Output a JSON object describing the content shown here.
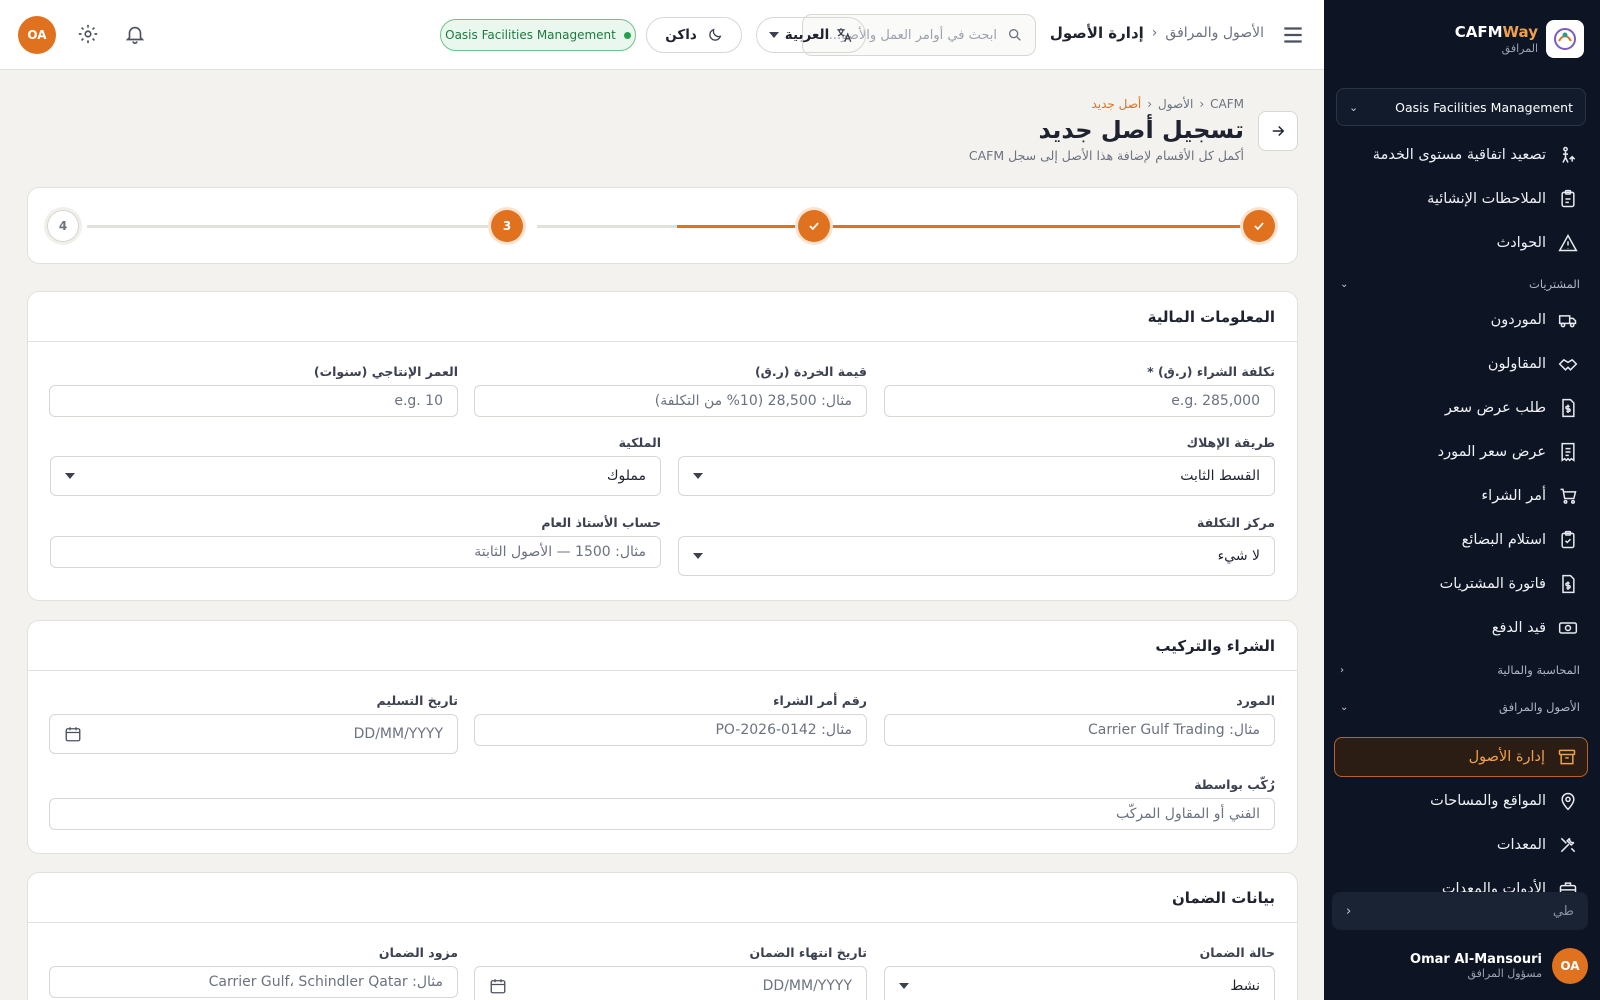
{
  "sidebar": {
    "brand": {
      "name_main": "CAFM",
      "name_accent": "Way",
      "subtitle": "المرافق"
    },
    "org": "Oasis Facilities Management",
    "items_top": [
      {
        "label": "تصعيد اتفاقية مستوى الخدمة",
        "icon": "escalation-icon"
      },
      {
        "label": "الملاحظات الإنشائية",
        "icon": "clipboard-icon"
      },
      {
        "label": "الحوادث",
        "icon": "warning-icon"
      }
    ],
    "section_procurement": "المشتريات",
    "items_procurement": [
      {
        "label": "الموردون",
        "icon": "truck-icon"
      },
      {
        "label": "المقاولون",
        "icon": "handshake-icon"
      },
      {
        "label": "طلب عرض سعر",
        "icon": "file-dollar-icon"
      },
      {
        "label": "عرض سعر المورد",
        "icon": "receipt-icon"
      },
      {
        "label": "أمر الشراء",
        "icon": "cart-icon"
      },
      {
        "label": "استلام البضائع",
        "icon": "clipboard-check-icon"
      },
      {
        "label": "فاتورة المشتريات",
        "icon": "invoice-icon"
      },
      {
        "label": "قيد الدفع",
        "icon": "cash-icon"
      }
    ],
    "section_accounting": "المحاسبة والمالية",
    "section_assets": "الأصول والمرافق",
    "items_assets": [
      {
        "label": "إدارة الأصول",
        "icon": "archive-icon",
        "active": true
      },
      {
        "label": "المواقع والمساحات",
        "icon": "map-pin-icon"
      },
      {
        "label": "المعدات",
        "icon": "tools-icon"
      },
      {
        "label": "الأدوات والمعدات",
        "icon": "toolbox-icon"
      }
    ],
    "collapse_label": "طي",
    "user": {
      "initials": "OA",
      "name": "Omar Al-Mansouri",
      "role": "مسؤول المرافق"
    }
  },
  "topbar": {
    "breadcrumb_parent": "الأصول والمرافق",
    "breadcrumb_current": "إدارة الأصول",
    "search_placeholder": "ابحث في أوامر العمل والأصو...",
    "language": "العربية",
    "theme": "داكن",
    "org_badge": "Oasis Facilities Management",
    "avatar_initials": "OA"
  },
  "page": {
    "breadcrumb": [
      "CAFM",
      "الأصول",
      "أصل جديد"
    ],
    "title": "تسجيل أصل جديد",
    "subtitle": "أكمل كل الأقسام لإضافة هذا الأصل إلى سجل CAFM"
  },
  "stepper": {
    "current_step": "3",
    "last_step": "4",
    "total_steps": 4,
    "completed": 2
  },
  "financial": {
    "title": "المعلومات المالية",
    "purchase_cost": {
      "label": "تكلفة الشراء (ر.ق) *",
      "placeholder": "e.g. 285,000"
    },
    "salvage_value": {
      "label": "قيمة الخردة (ر.ق)",
      "placeholder": "مثال: 28,500 (10% من التكلفة)"
    },
    "useful_life": {
      "label": "العمر الإنتاجي (سنوات)",
      "placeholder": "e.g. 10"
    },
    "depreciation": {
      "label": "طريقة الإهلاك",
      "value": "القسط الثابت"
    },
    "ownership": {
      "label": "الملكية",
      "value": "مملوك"
    },
    "cost_center": {
      "label": "مركز التكلفة",
      "value": "لا شيء"
    },
    "gl_account": {
      "label": "حساب الأستاذ العام",
      "placeholder": "مثال: 1500 — الأصول الثابتة"
    }
  },
  "procurement": {
    "title": "الشراء والتركيب",
    "supplier": {
      "label": "المورد",
      "placeholder": "مثال: Carrier Gulf Trading"
    },
    "po_number": {
      "label": "رقم أمر الشراء",
      "placeholder": "مثال: PO-2026-0142"
    },
    "delivery_date": {
      "label": "تاريخ التسليم",
      "placeholder": "DD/MM/YYYY"
    },
    "installed_by": {
      "label": "رُكّب بواسطة",
      "placeholder": "الفني أو المقاول المركّب"
    }
  },
  "warranty": {
    "title": "بيانات الضمان",
    "status": {
      "label": "حالة الضمان",
      "value": "نشط"
    },
    "expiry": {
      "label": "تاريخ انتهاء الضمان",
      "placeholder": "DD/MM/YYYY"
    },
    "provider": {
      "label": "مزود الضمان",
      "placeholder": "مثال: Carrier Gulf، Schindler Qatar"
    }
  },
  "colors": {
    "accent": "#e0711f",
    "sidebar_bg": "#0d1524",
    "page_bg": "#f4f2ee",
    "success": "#22a24a"
  }
}
